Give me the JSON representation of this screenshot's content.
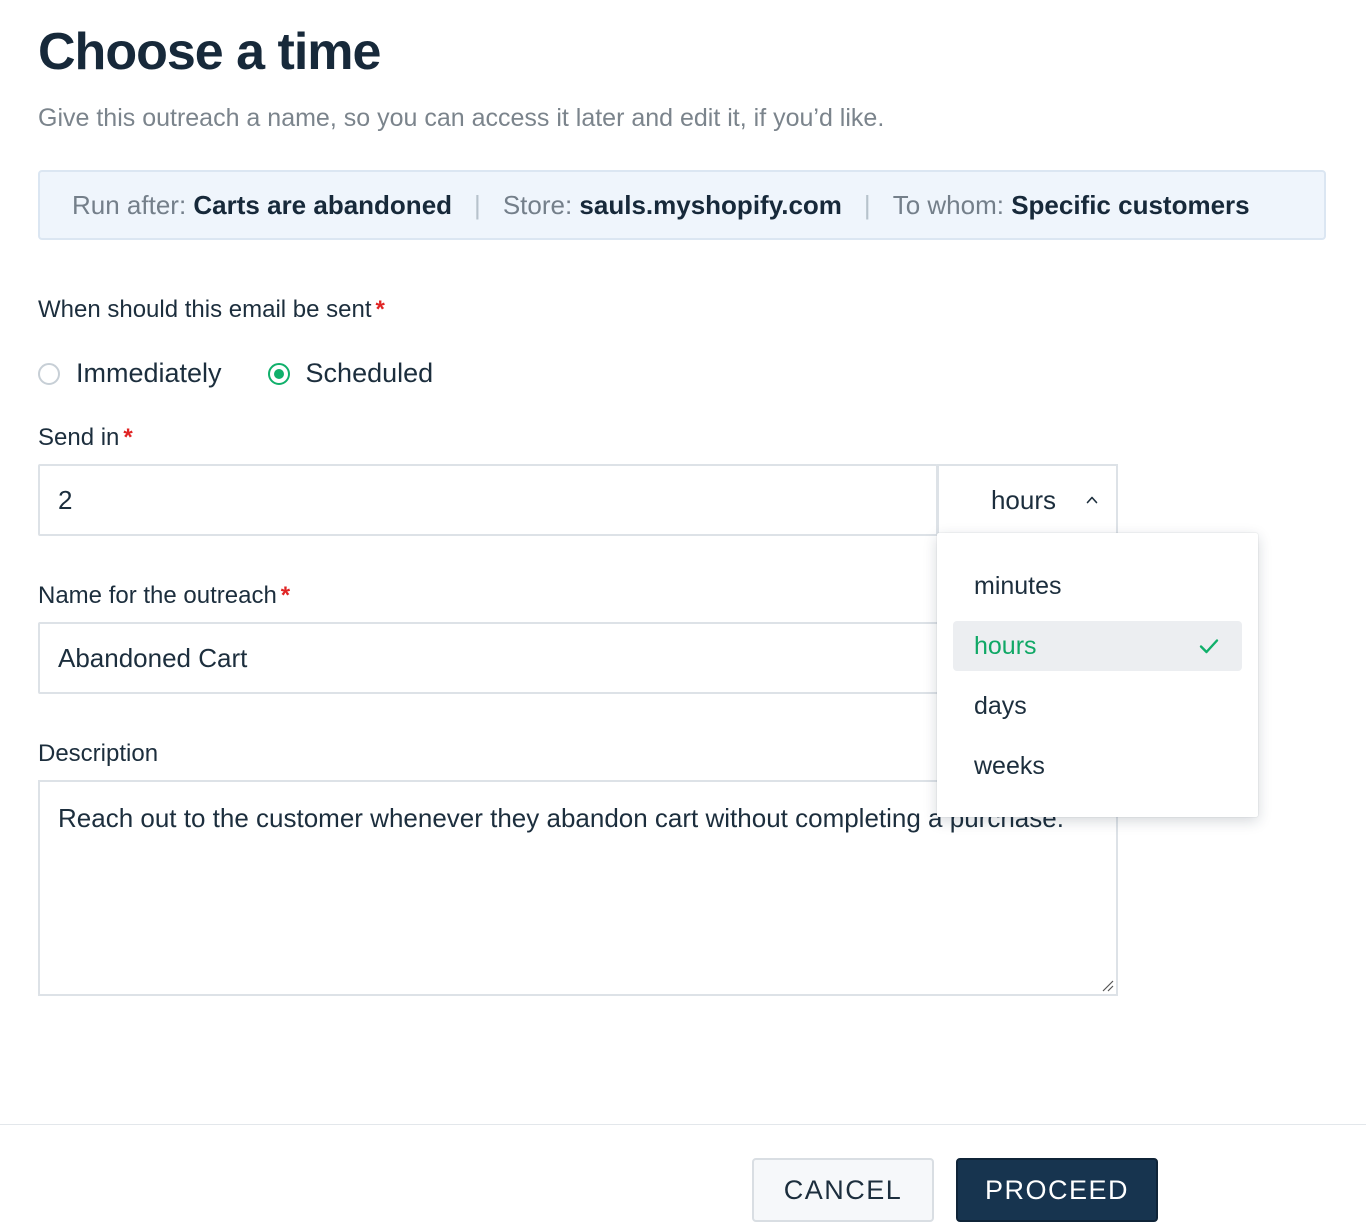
{
  "page": {
    "title": "Choose a time",
    "subtitle": "Give this outreach a name, so you can access it later and edit it, if you’d like."
  },
  "summary": {
    "run_after_label": "Run after:",
    "run_after_value": "Carts are abandoned",
    "store_label": "Store:",
    "store_value": "sauls.myshopify.com",
    "to_whom_label": "To whom:",
    "to_whom_value": "Specific customers",
    "separator": "|"
  },
  "when": {
    "label": "When should this email be sent",
    "required_mark": "*",
    "options": [
      {
        "label": "Immediately",
        "checked": false
      },
      {
        "label": "Scheduled",
        "checked": true
      }
    ]
  },
  "send_in": {
    "label": "Send in",
    "required_mark": "*",
    "value": "2",
    "unit": "hours",
    "unit_options": [
      {
        "label": "minutes",
        "selected": false
      },
      {
        "label": "hours",
        "selected": true
      },
      {
        "label": "days",
        "selected": false
      },
      {
        "label": "weeks",
        "selected": false
      }
    ]
  },
  "name": {
    "label": "Name for the outreach",
    "required_mark": "*",
    "value": "Abandoned Cart"
  },
  "description": {
    "label": "Description",
    "value": "Reach out to the customer whenever they abandon cart without completing a purchase."
  },
  "footer": {
    "cancel_label": "CANCEL",
    "proceed_label": "PROCEED"
  },
  "colors": {
    "accent_green": "#10b06b",
    "primary_button": "#17344f",
    "required_red": "#e02424"
  },
  "icons": {
    "chevron": "chevron-up-icon",
    "check": "check-icon",
    "resize": "resize-handle-icon"
  }
}
